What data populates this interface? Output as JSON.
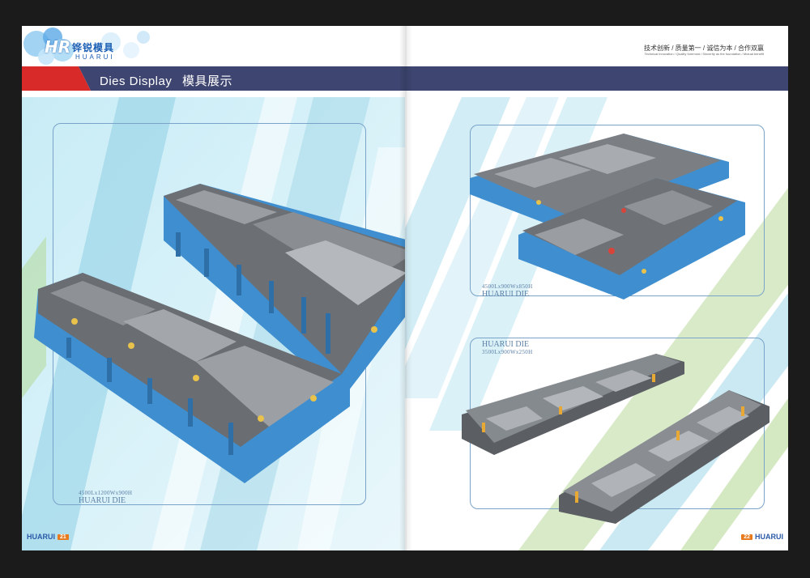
{
  "brand": {
    "logo_mark": "HR",
    "logo_cn": "铧锐模具",
    "logo_en": "HUARUI"
  },
  "header": {
    "section_title": "Dies Display",
    "section_title_cn": "模具展示",
    "slogan": "技术创新 / 质量第一 / 诚信为本 / 合作双赢",
    "slogan_en": "Technical innovation / Quality foremost / Sincerity as the foundation / Mutual benefit"
  },
  "products": [
    {
      "dims": "4500Lx1200Wx900H",
      "name": "HUARUI DIE"
    },
    {
      "dims": "4500Lx900Wx850H",
      "name": "HUARUI DIE"
    },
    {
      "dims": "3500Lx900Wx250H",
      "name": "HUARUI DIE"
    }
  ],
  "footer": {
    "left_brand": "HUARUI",
    "left_page": "21",
    "right_brand": "HUARUI",
    "right_page": "22"
  },
  "colors": {
    "band": "#3d4570",
    "accent_red": "#d92a2a",
    "die_blue": "#3f8fd0",
    "stripe_cyan": "#a9dbea",
    "stripe_green": "#b8d99a"
  }
}
